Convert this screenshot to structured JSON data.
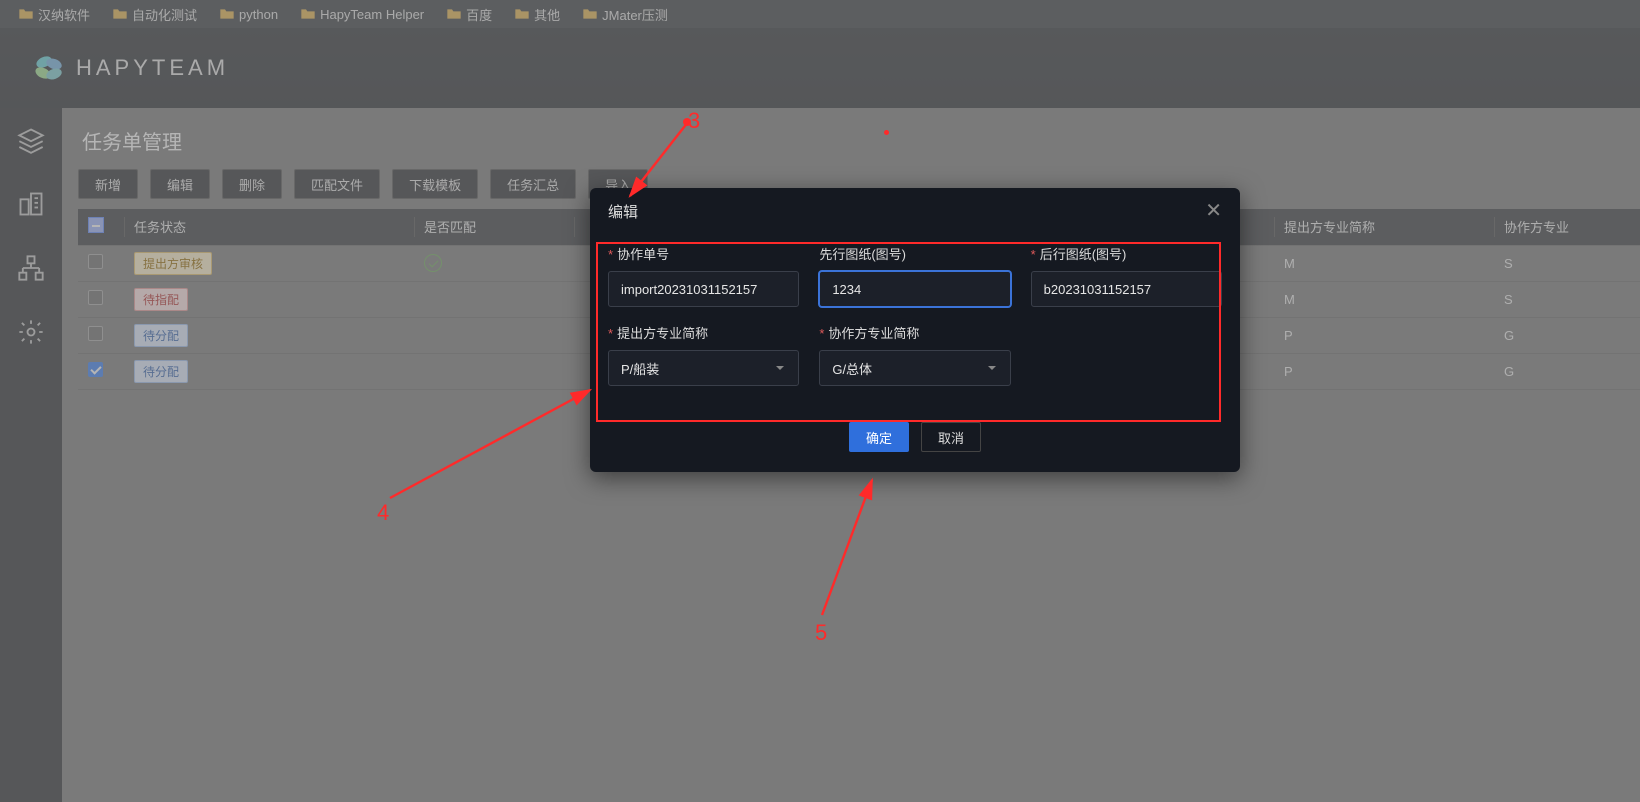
{
  "bookmarks": [
    {
      "label": "汉纳软件"
    },
    {
      "label": "自动化测试"
    },
    {
      "label": "python"
    },
    {
      "label": "HapyTeam Helper"
    },
    {
      "label": "百度"
    },
    {
      "label": "其他"
    },
    {
      "label": "JMater压测"
    }
  ],
  "brand": "HAPYTEAM",
  "page_title": "任务单管理",
  "toolbar": {
    "new": "新增",
    "edit": "编辑",
    "delete": "删除",
    "match_file": "匹配文件",
    "download_tpl": "下载模板",
    "task_summary": "任务汇总",
    "import": "导入"
  },
  "table": {
    "headers": {
      "status": "任务状态",
      "match": "是否匹配",
      "prof1": "提出方专业简称",
      "prof2": "协作方专业"
    },
    "rows": [
      {
        "checked": false,
        "status_tag": {
          "text": "提出方审核",
          "cls": "tag-orange"
        },
        "match": true,
        "prof1": "M",
        "prof2": "S"
      },
      {
        "checked": false,
        "status_tag": {
          "text": "待指配",
          "cls": "tag-red"
        },
        "match": false,
        "prof1": "M",
        "prof2": "S"
      },
      {
        "checked": false,
        "status_tag": {
          "text": "待分配",
          "cls": "tag-blue"
        },
        "match": false,
        "prof1": "P",
        "prof2": "G"
      },
      {
        "checked": true,
        "status_tag": {
          "text": "待分配",
          "cls": "tag-blue"
        },
        "match": false,
        "prof1": "P",
        "prof2": "G"
      }
    ]
  },
  "dialog": {
    "title": "编辑",
    "fields": {
      "coop_no": {
        "label": "协作单号",
        "required": true,
        "value": "import20231031152157"
      },
      "pre_draw": {
        "label": "先行图纸(图号)",
        "required": false,
        "value": "1234",
        "focused": true
      },
      "post_draw": {
        "label": "后行图纸(图号)",
        "required": true,
        "value": "b20231031152157"
      },
      "prof_a": {
        "label": "提出方专业简称",
        "required": true,
        "value": "P/船装"
      },
      "prof_b": {
        "label": "协作方专业简称",
        "required": true,
        "value": "G/总体"
      }
    },
    "ok": "确定",
    "cancel": "取消"
  },
  "annotations": {
    "n3": "3",
    "n4": "4",
    "n5": "5"
  }
}
